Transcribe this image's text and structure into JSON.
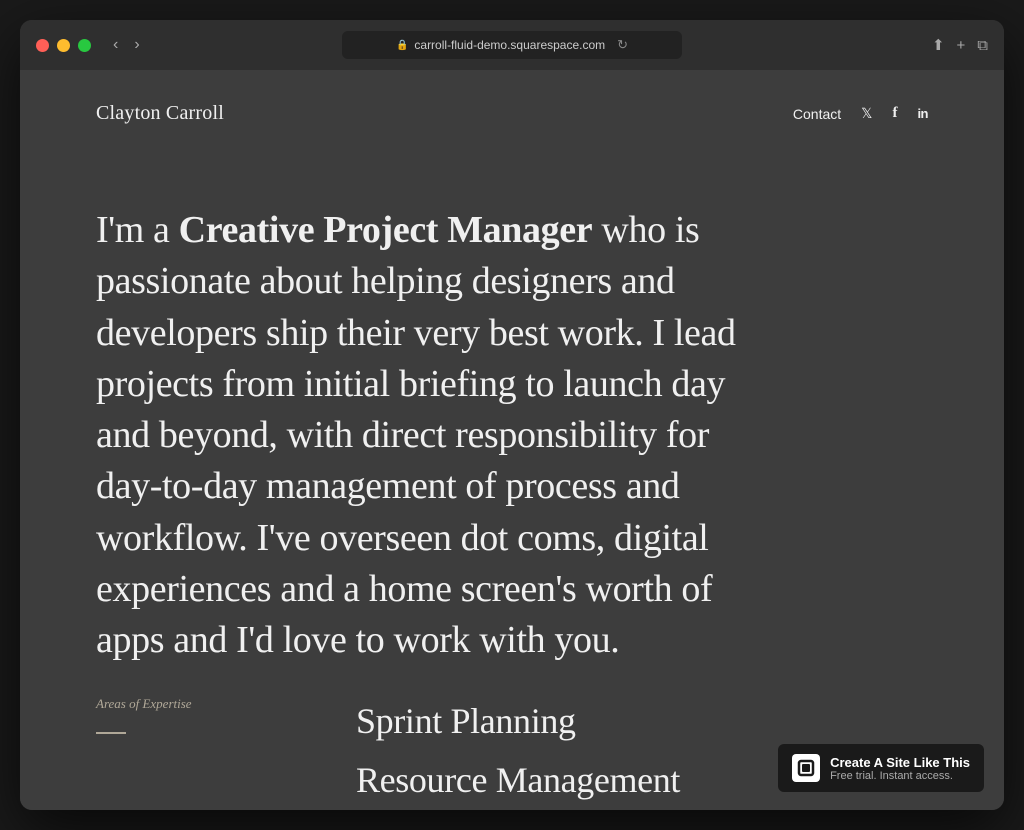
{
  "browser": {
    "url": "carroll-fluid-demo.squarespace.com",
    "traffic_lights": [
      "red",
      "yellow",
      "green"
    ]
  },
  "site": {
    "logo": "Clayton Carroll",
    "nav": {
      "contact_label": "Contact",
      "social": [
        {
          "name": "twitter",
          "symbol": "𝕏",
          "label": "Twitter"
        },
        {
          "name": "facebook",
          "symbol": "f",
          "label": "Facebook"
        },
        {
          "name": "linkedin",
          "symbol": "in",
          "label": "LinkedIn"
        }
      ]
    },
    "hero": {
      "text_before_bold": "I'm a ",
      "bold_text": "Creative Project Manager",
      "text_after": " who is passionate about helping designers and developers ship their very best work. I lead projects from initial briefing to launch day and beyond, with direct responsibility for day-to-day management of process and workflow. I've overseen dot coms, digital experiences and a home screen's worth of apps and I'd love to work with you."
    },
    "expertise": {
      "label": "Areas of Expertise",
      "items": [
        "Sprint Planning",
        "Resource Management"
      ]
    }
  },
  "squarespace_banner": {
    "title": "Create A Site Like This",
    "subtitle": "Free trial. Instant access."
  }
}
